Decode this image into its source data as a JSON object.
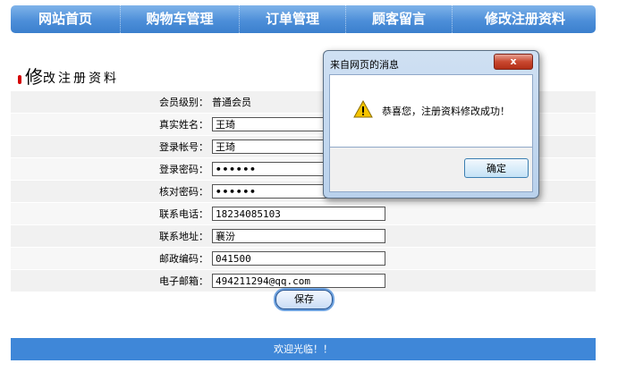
{
  "nav": {
    "items": [
      {
        "label": "网站首页"
      },
      {
        "label": "购物车管理"
      },
      {
        "label": "订单管理"
      },
      {
        "label": "顾客留言"
      },
      {
        "label": "修改注册资料"
      }
    ]
  },
  "page": {
    "title_first": "修",
    "title_rest": "改注册资料"
  },
  "form": {
    "level": {
      "label": "会员级别：",
      "value": "普通会员"
    },
    "real_name": {
      "label": "真实姓名：",
      "value": "王琦"
    },
    "account": {
      "label": "登录帐号：",
      "value": "王琦"
    },
    "password": {
      "label": "登录密码：",
      "value": "••••••"
    },
    "confirm": {
      "label": "核对密码：",
      "value": "••••••"
    },
    "phone": {
      "label": "联系电话：",
      "value": "18234085103"
    },
    "address": {
      "label": "联系地址：",
      "value": "襄汾"
    },
    "zip": {
      "label": "邮政编码：",
      "value": "041500"
    },
    "email": {
      "label": "电子邮箱：",
      "value": "494211294@qq.com"
    },
    "save_label": "保存"
  },
  "footer": {
    "text": "欢迎光临！！"
  },
  "dialog": {
    "title": "来自网页的消息",
    "close_label": "x",
    "message": "恭喜您，注册资料修改成功！",
    "ok_label": "确定",
    "icon": "warning-icon"
  },
  "colors": {
    "nav": "#4d8fd9",
    "footer": "#3f87d8",
    "title_bullet": "#d40000"
  }
}
